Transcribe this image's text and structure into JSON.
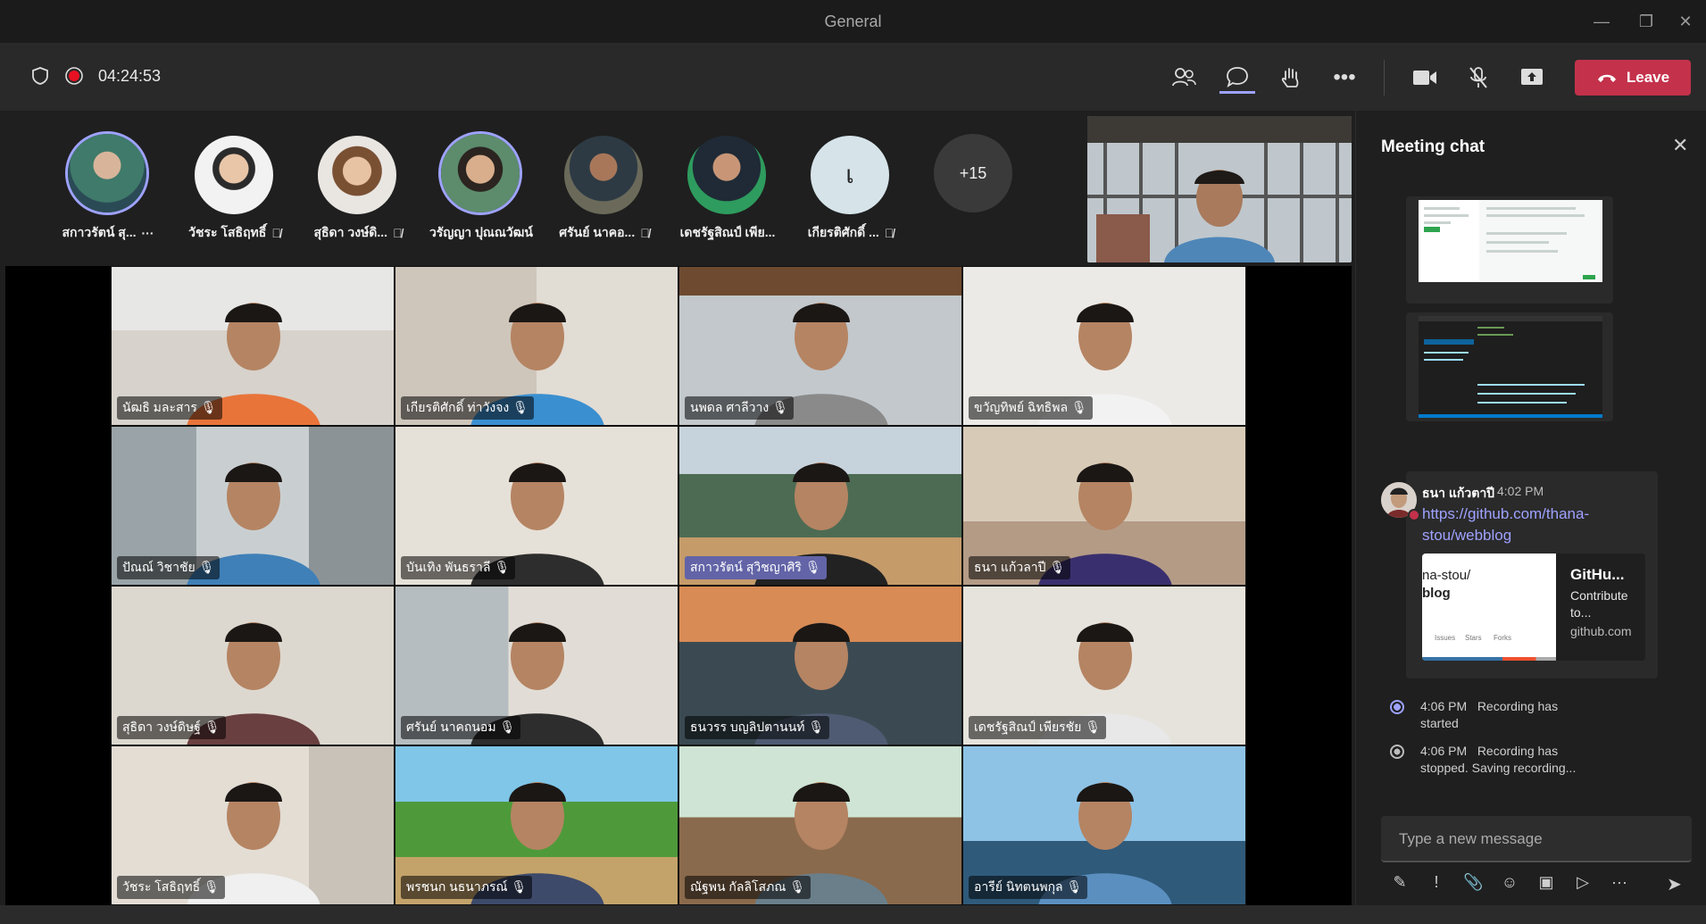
{
  "window": {
    "title": "General",
    "minimize": "—",
    "restore": "❐",
    "close": "✕"
  },
  "toolbar": {
    "timer": "04:24:53",
    "leave_label": "Leave"
  },
  "avatars": [
    {
      "name": "สกาวรัตน์ สุ...",
      "extra": "···",
      "active": true
    },
    {
      "name": "วัชระ โสธิฤทธิ์",
      "active": false
    },
    {
      "name": "สุธิดา วงษ์ดิ...",
      "active": false
    },
    {
      "name": "วรัญญา ปุณณวัฒน์",
      "active": true
    },
    {
      "name": "ศรันย์ นาคอ...",
      "active": false
    },
    {
      "name": "เดชรัฐสิณป์ เพีย...",
      "active": false
    },
    {
      "name": "เกียรติศักดิ์ ...",
      "initial": "เ",
      "active": false
    },
    {
      "overflow": "+15"
    }
  ],
  "tiles": [
    "นัฒธิ มละสาร",
    "เกียรติศักดิ์ ท่าวังจง",
    "นพดล ศาลีวาง",
    "ขวัญทิพย์ ฉิทธิพล",
    "ปัณณ์ วิชาชัย",
    "บันเทิง พันธราลี",
    "สกาวรัตน์ สุวิชญาศิริ",
    "ธนา แก้วลาปี",
    "สุธิดา วงษ์ดิษฐ์",
    "ศรันย์ นาคถนอม",
    "ธนวรร บญลิปตานนท์",
    "เดชรัฐสิณป์ เพียรชัย",
    "วัชระ โสธิฤทธิ์",
    "พรชนก นธนาภรณ์",
    "ณัฐพน กัลลิโสภณ",
    "อารีย์ นิทตนพกุล"
  ],
  "chat": {
    "title": "Meeting chat",
    "message": {
      "sender": "ธนา แก้วตาปี",
      "time": "4:02 PM",
      "link": "https://github.com/thana-stou/webblog",
      "preview_img_text1": "na-stou/",
      "preview_img_text2": "blog",
      "preview_title": "GitHu...",
      "preview_desc": "Contribute to...",
      "preview_site": "github.com",
      "preview_stat1": "Issues",
      "preview_stat2": "Stars",
      "preview_stat3": "Forks"
    },
    "events": [
      {
        "time": "4:06 PM",
        "text": "Recording has started"
      },
      {
        "time": "4:06 PM",
        "text": "Recording has stopped. Saving recording..."
      }
    ],
    "compose_placeholder": "Type a new message"
  },
  "colors": {
    "accent": "#6264a7",
    "leave": "#c4314b",
    "record": "#e81123",
    "link": "#9ea2ff"
  }
}
